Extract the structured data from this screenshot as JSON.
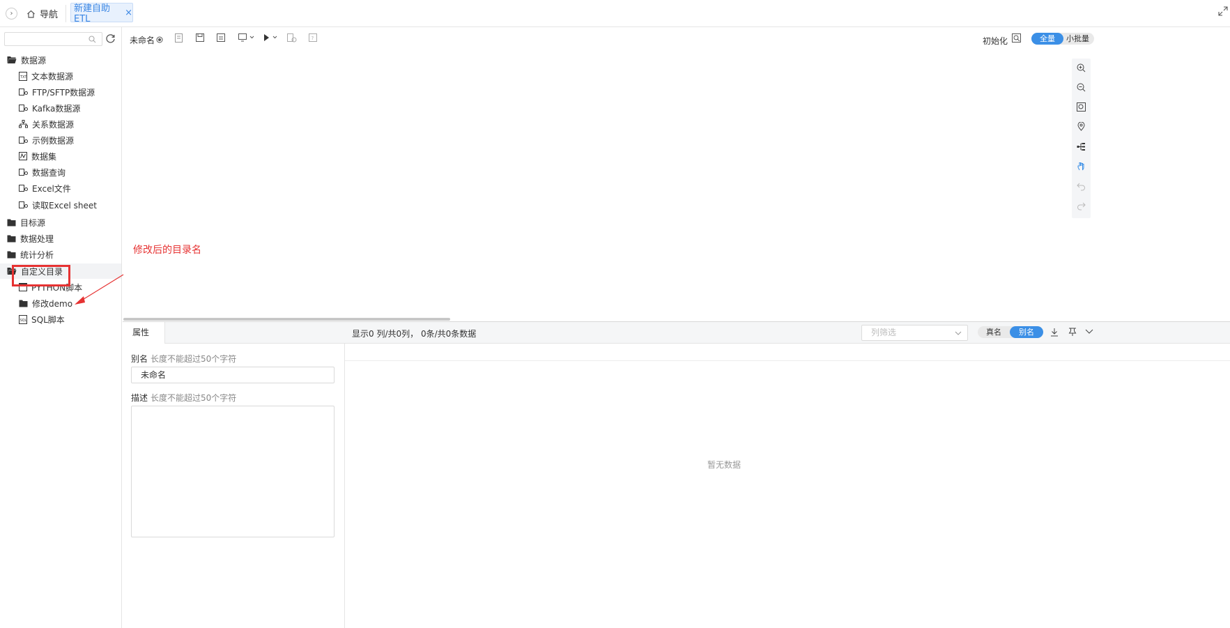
{
  "topbar": {
    "collapse_glyph": "›",
    "nav_label": "导航",
    "active_tab_label": "新建自助ETL",
    "tab_close_glyph": "×"
  },
  "sidebar": {
    "search_placeholder": "",
    "folders": [
      {
        "label": "数据源",
        "open": true
      },
      {
        "label": "目标源",
        "open": false
      },
      {
        "label": "数据处理",
        "open": false
      },
      {
        "label": "统计分析",
        "open": false
      },
      {
        "label": "自定义目录",
        "open": true
      }
    ],
    "datasource_items": [
      {
        "label": "文本数据源",
        "icon": "txt-file-icon"
      },
      {
        "label": "FTP/SFTP数据源",
        "icon": "db-link-icon"
      },
      {
        "label": "Kafka数据源",
        "icon": "db-link-icon"
      },
      {
        "label": "关系数据源",
        "icon": "relation-icon"
      },
      {
        "label": "示例数据源",
        "icon": "db-link-icon"
      },
      {
        "label": "数据集",
        "icon": "dataset-icon"
      },
      {
        "label": "数据查询",
        "icon": "db-link-icon"
      },
      {
        "label": "Excel文件",
        "icon": "db-link-icon"
      },
      {
        "label": "读取Excel sheet",
        "icon": "db-link-icon"
      }
    ],
    "custom_items": [
      {
        "label": "PYTHON脚本",
        "icon": "python-script-icon"
      },
      {
        "label": "修改demo",
        "icon": "folder-icon"
      },
      {
        "label": "SQL脚本",
        "icon": "sql-script-icon"
      }
    ]
  },
  "annotation": {
    "text": "修改后的目录名",
    "color": "#e63232"
  },
  "toolbar": {
    "doc_name": "未命名",
    "init_label": "初始化",
    "mode_full": "全量",
    "mode_batch": "小批量"
  },
  "properties": {
    "tab_label": "属性",
    "alias_label": "别名",
    "alias_hint": "长度不能超过50个字符",
    "alias_value": "未命名",
    "desc_label": "描述",
    "desc_hint": "长度不能超过50个字符",
    "desc_value": ""
  },
  "data_view": {
    "summary": "显示0 列/共0列， 0条/共0条数据",
    "column_filter_placeholder": "列筛选",
    "real_name_label": "真名",
    "alias_label": "别名",
    "empty_text": "暂无数据"
  },
  "colors": {
    "accent": "#3b8fe6",
    "tab_bg": "#e8f1fd",
    "highlight_red": "#e63232"
  }
}
